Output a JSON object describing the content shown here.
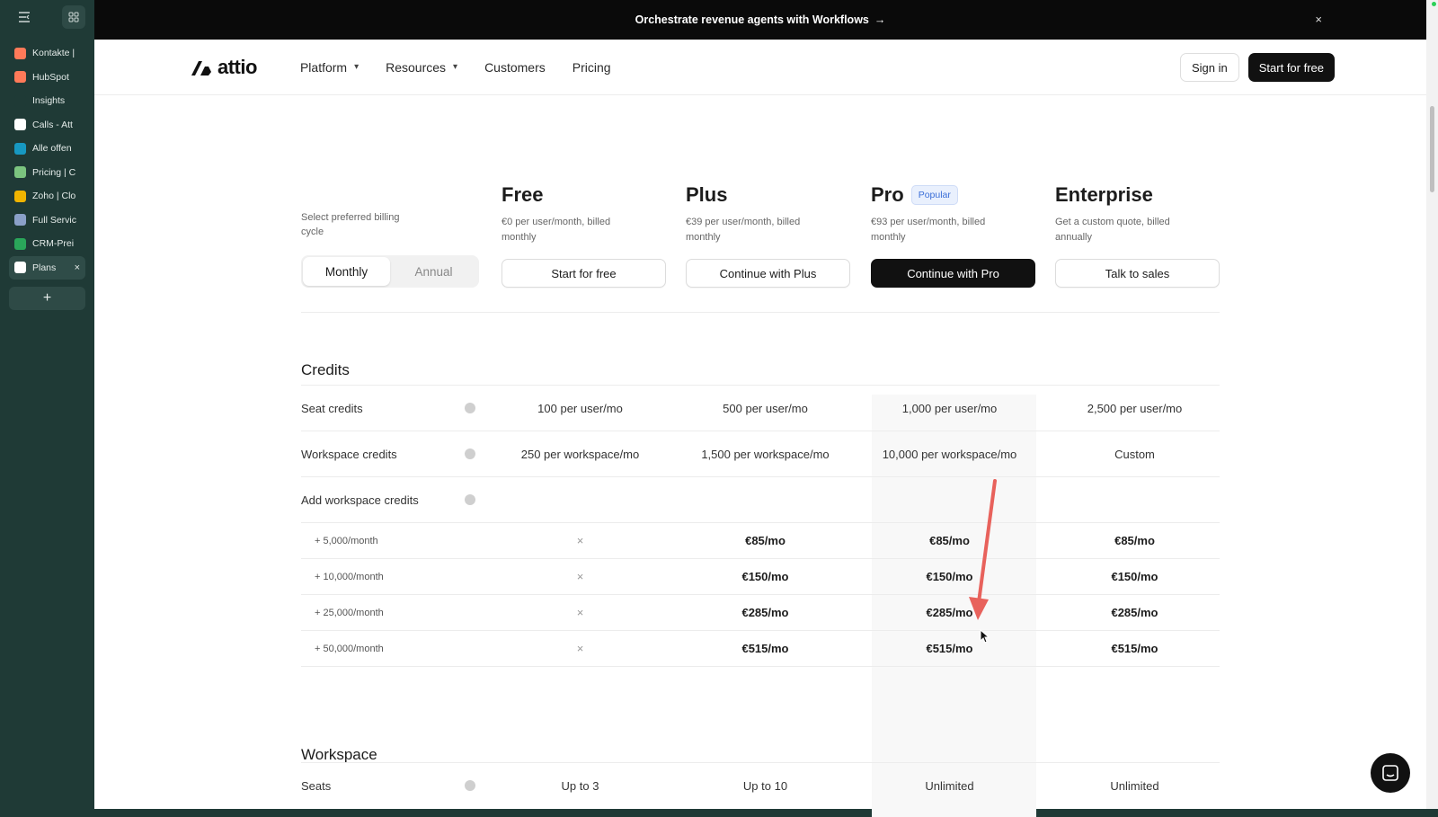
{
  "browser_sidebar": {
    "tabs": [
      {
        "label": "Kontakte |",
        "icon": "hubspot-sprocket-icon",
        "color": "#ff7a59"
      },
      {
        "label": "HubSpot",
        "icon": "hubspot-logo-icon",
        "color": "#ff7a59"
      },
      {
        "label": "Insights",
        "icon": "p-icon",
        "color": "#1f3a36"
      },
      {
        "label": "Calls - Att",
        "icon": "attio-icon",
        "color": "#ffffff"
      },
      {
        "label": "Alle offen",
        "icon": "salesforce-cloud-icon",
        "color": "#1798c1"
      },
      {
        "label": "Pricing | C",
        "icon": "pricing-gear-icon",
        "color": "#7bc47f"
      },
      {
        "label": "Zoho | Clo",
        "icon": "zoho-icon",
        "color": "#f0b400"
      },
      {
        "label": "Full Servic",
        "icon": "bars-icon",
        "color": "#8aa0c8"
      },
      {
        "label": "CRM-Prei",
        "icon": "p-green-icon",
        "color": "#2aa65a"
      },
      {
        "label": "Plans",
        "icon": "attio-icon",
        "color": "#ffffff",
        "active": true
      }
    ],
    "add_tab": "+"
  },
  "banner": {
    "text": "Orchestrate revenue agents with Workflows",
    "arrow": "→",
    "close": "×"
  },
  "nav": {
    "logo": "attio",
    "items": [
      {
        "label": "Platform",
        "dropdown": true
      },
      {
        "label": "Resources",
        "dropdown": true
      },
      {
        "label": "Customers",
        "dropdown": false
      },
      {
        "label": "Pricing",
        "dropdown": false
      }
    ],
    "sign_in": "Sign in",
    "start_free": "Start for free"
  },
  "billing": {
    "label": "Select preferred billing cycle",
    "options": [
      "Monthly",
      "Annual"
    ],
    "selected": "Monthly"
  },
  "plans": [
    {
      "name": "Free",
      "desc": "€0 per user/month, billed monthly",
      "cta": "Start for free",
      "dark": false
    },
    {
      "name": "Plus",
      "desc": "€39 per user/month, billed monthly",
      "cta": "Continue with Plus",
      "dark": false
    },
    {
      "name": "Pro",
      "badge": "Popular",
      "desc": "€93 per user/month, billed monthly",
      "cta": "Continue with Pro",
      "dark": true
    },
    {
      "name": "Enterprise",
      "desc": "Get a custom quote, billed annually",
      "cta": "Talk to sales",
      "dark": false
    }
  ],
  "credits": {
    "title": "Credits",
    "rows": [
      {
        "label": "Seat credits",
        "values": [
          "100 per user/mo",
          "500 per user/mo",
          "1,000 per user/mo",
          "2,500 per user/mo"
        ]
      },
      {
        "label": "Workspace credits",
        "values": [
          "250 per workspace/mo",
          "1,500 per workspace/mo",
          "10,000 per workspace/mo",
          "Custom"
        ]
      },
      {
        "label": "Add workspace credits",
        "values": [
          "",
          "",
          "",
          ""
        ]
      }
    ],
    "addons": [
      {
        "label": "+ 5,000/month",
        "values": [
          "×",
          "€85/mo",
          "€85/mo",
          "€85/mo"
        ]
      },
      {
        "label": "+ 10,000/month",
        "values": [
          "×",
          "€150/mo",
          "€150/mo",
          "€150/mo"
        ]
      },
      {
        "label": "+ 25,000/month",
        "values": [
          "×",
          "€285/mo",
          "€285/mo",
          "€285/mo"
        ]
      },
      {
        "label": "+ 50,000/month",
        "values": [
          "×",
          "€515/mo",
          "€515/mo",
          "€515/mo"
        ]
      }
    ]
  },
  "workspace": {
    "title": "Workspace",
    "rows": [
      {
        "label": "Seats",
        "values": [
          "Up to 3",
          "Up to 10",
          "Unlimited",
          "Unlimited"
        ]
      }
    ]
  },
  "colors": {
    "annotation_arrow": "#e8625c",
    "accent_dark": "#111111",
    "badge_blue": "#3b6fd8"
  }
}
